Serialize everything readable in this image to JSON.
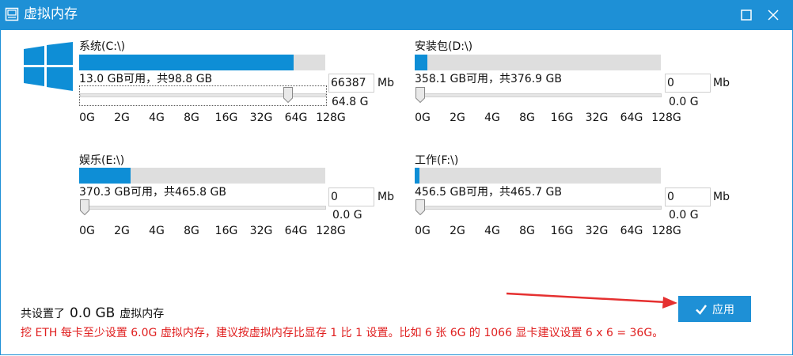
{
  "window": {
    "title": "虚拟内存",
    "accent_color": "#1e90d6",
    "icons": [
      "app-icon",
      "maximize-icon",
      "close-icon",
      "windows-logo-icon"
    ]
  },
  "tick_labels": [
    "0G",
    "2G",
    "4G",
    "8G",
    "16G",
    "32G",
    "64G",
    "128G"
  ],
  "drives": [
    {
      "name": "系统(C:\\)",
      "used_fraction": 0.87,
      "free_text": "13.0 GB可用，共98.8 GB",
      "input_value": "66387",
      "unit": "Mb",
      "size_gb": "64.8 G",
      "slider_fraction": 0.86
    },
    {
      "name": "安装包(D:\\)",
      "used_fraction": 0.05,
      "free_text": "358.1 GB可用，共376.9 GB",
      "input_value": "0",
      "unit": "Mb",
      "size_gb": "0.0 G",
      "slider_fraction": 0.0
    },
    {
      "name": "娱乐(E:\\)",
      "used_fraction": 0.21,
      "free_text": "370.3 GB可用，共465.8 GB",
      "input_value": "0",
      "unit": "Mb",
      "size_gb": "0.0 G",
      "slider_fraction": 0.0
    },
    {
      "name": "工作(F:\\)",
      "used_fraction": 0.02,
      "free_text": "456.5 GB可用，共465.7 GB",
      "input_value": "0",
      "unit": "Mb",
      "size_gb": "0.0 G",
      "slider_fraction": 0.0
    }
  ],
  "footer": {
    "total_prefix": "共设置了",
    "total_value": "0.0 GB",
    "total_suffix": "虚拟内存",
    "note": "挖 ETH 每卡至少设置 6.0G 虚拟内存，建议按虚拟内存比显存 1 比 1 设置。比如 6 张 6G 的 1066 显卡建议设置 6 x 6 = 36G。",
    "note_color": "#e02020"
  },
  "apply_button": {
    "label": "应用",
    "icon": "check-icon"
  }
}
